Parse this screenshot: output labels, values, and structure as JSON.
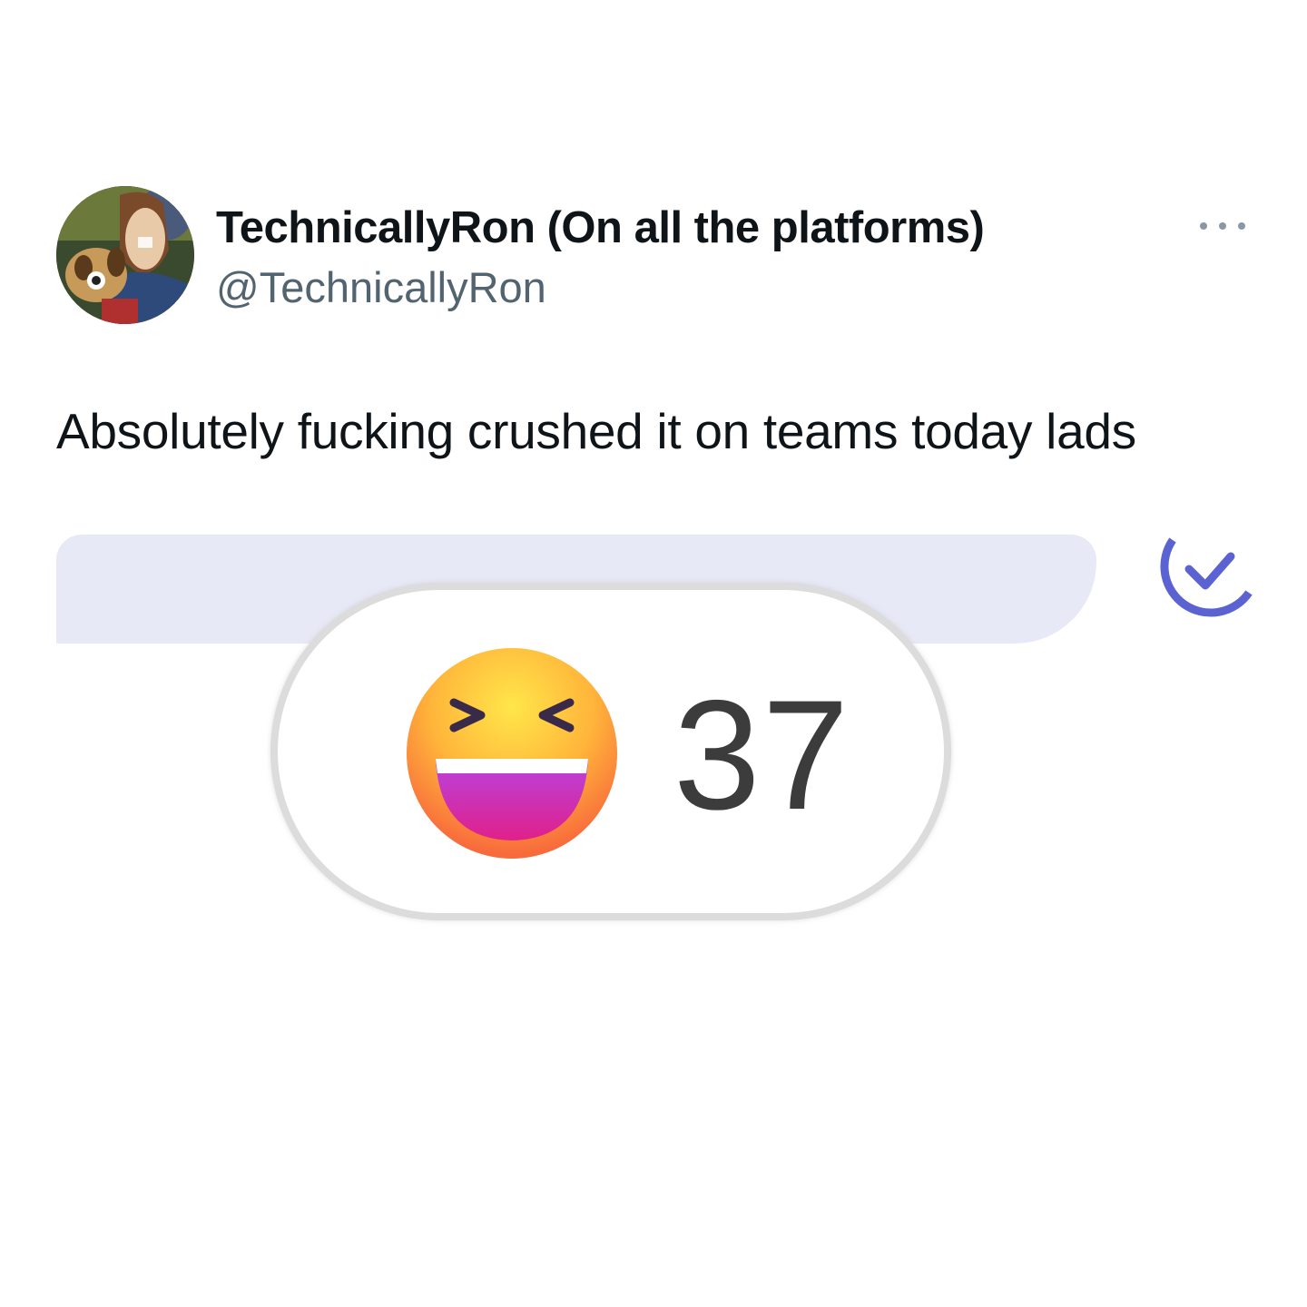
{
  "tweet": {
    "display_name": "TechnicallyRon (On all the platforms)",
    "handle": "@TechnicallyRon",
    "text": "Absolutely fucking crushed it on teams today lads",
    "more_icon": "more-horizontal-icon"
  },
  "teams_screenshot": {
    "bubble_color": "#e7e9f7",
    "seen_icon": "seen-check-icon",
    "seen_color": "#5b63d3",
    "reaction": {
      "emoji_icon": "laughing-emoji-icon",
      "count": "37"
    }
  }
}
